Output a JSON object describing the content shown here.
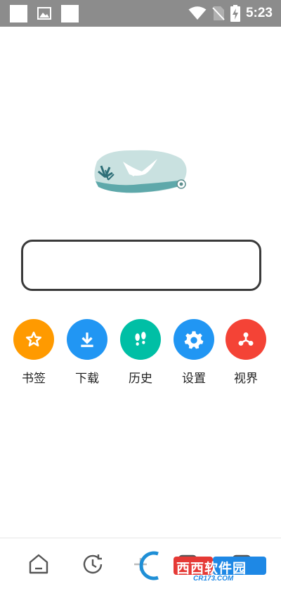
{
  "status_bar": {
    "time": "5:23",
    "icons": [
      "notification-square-icon",
      "image-icon",
      "notification-square-icon",
      "wifi-icon",
      "no-sim-icon",
      "battery-charging-icon"
    ]
  },
  "logo": {
    "icon": "seagull-logo"
  },
  "search": {
    "placeholder": ""
  },
  "shortcuts": [
    {
      "label": "书签",
      "icon": "bookmark-star-icon",
      "color": "#FF9A00"
    },
    {
      "label": "下载",
      "icon": "download-icon",
      "color": "#2196F3"
    },
    {
      "label": "历史",
      "icon": "footprints-icon",
      "color": "#00BFA5"
    },
    {
      "label": "设置",
      "icon": "gear-icon",
      "color": "#2196F3"
    },
    {
      "label": "视界",
      "icon": "vision-icon",
      "color": "#F44336"
    }
  ],
  "bottom_nav": {
    "items": [
      "home-icon",
      "history-clock-icon",
      "add-icon",
      "tabs-icon",
      "menu-icon"
    ]
  },
  "watermark": {
    "brand": "西西软件园",
    "site": "CR173.COM"
  }
}
